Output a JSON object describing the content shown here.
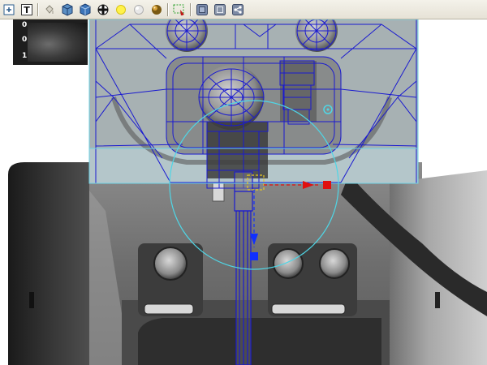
{
  "toolbar": {
    "buttons": [
      {
        "icon": "view-all-icon"
      },
      {
        "icon": "text-tool-icon",
        "label": "T"
      },
      {
        "icon": "paint-bucket-icon"
      },
      {
        "icon": "cube-view-icon"
      },
      {
        "icon": "cube-textured-icon"
      },
      {
        "icon": "checker-sphere-icon"
      },
      {
        "icon": "light-bulb-icon"
      },
      {
        "icon": "white-sphere-icon"
      },
      {
        "icon": "shaded-sphere-icon"
      },
      {
        "icon": "region-select-icon"
      },
      {
        "icon": "box-object-icon"
      },
      {
        "icon": "grid-box-icon"
      },
      {
        "icon": "share-node-icon"
      }
    ]
  },
  "thumbnail": {
    "labels": [
      "0",
      "0",
      "1"
    ]
  },
  "colors": {
    "wireframe": "#1a1ad0",
    "selection_circle": "#4fd6e6",
    "x_axis": "#e01010",
    "y_axis": "#1030ff",
    "bounding_box": "#6fd3e6",
    "pivot": "#e8c820"
  }
}
